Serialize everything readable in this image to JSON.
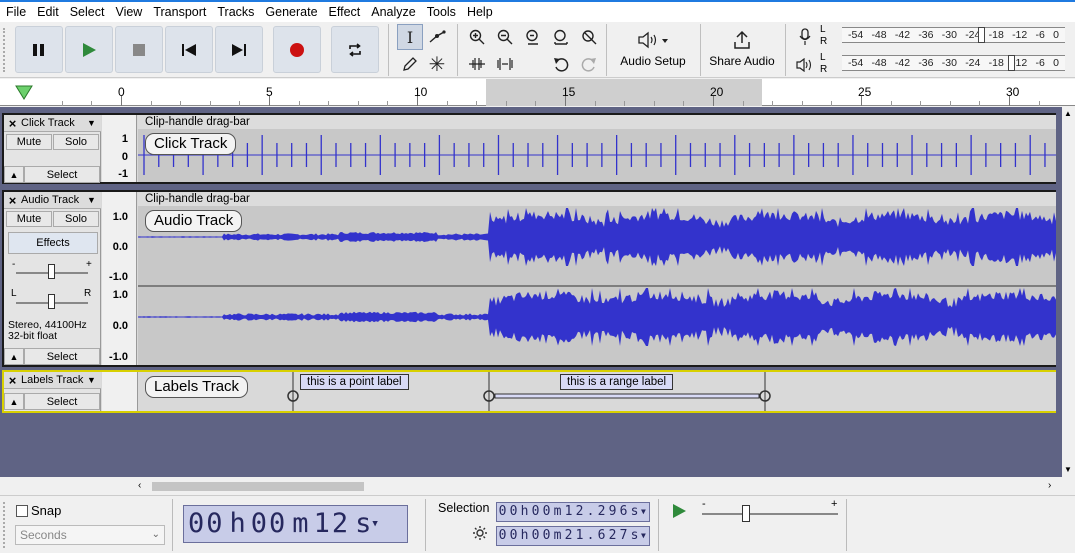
{
  "menu": [
    "File",
    "Edit",
    "Select",
    "View",
    "Transport",
    "Tracks",
    "Generate",
    "Effect",
    "Analyze",
    "Tools",
    "Help"
  ],
  "toolbar": {
    "audio_setup_label": "Audio Setup",
    "share_audio_label": "Share Audio",
    "record_meter_labels": [
      "-54",
      "-48",
      "-42",
      "-36",
      "-30",
      "-24",
      "-18",
      "-12",
      "-6",
      "0"
    ],
    "play_meter_labels": [
      "-54",
      "-48",
      "-42",
      "-36",
      "-30",
      "-24",
      "-18",
      "-12",
      "-6",
      "0"
    ],
    "meter_channel_l": "L",
    "meter_channel_r": "R"
  },
  "ruler": {
    "labels": [
      "0",
      "5",
      "10",
      "15",
      "20",
      "25",
      "30"
    ],
    "selection_start": 12.296,
    "selection_end": 21.627
  },
  "tracks": {
    "click": {
      "name": "Click Track",
      "mute": "Mute",
      "solo": "Solo",
      "select": "Select",
      "drag_bar": "Clip-handle drag-bar",
      "label": "Click Track",
      "scale": [
        "1",
        "0",
        "-1"
      ]
    },
    "audio": {
      "name": "Audio Track",
      "mute": "Mute",
      "solo": "Solo",
      "effects": "Effects",
      "pan_left": "L",
      "pan_right": "R",
      "gain_minus": "-",
      "gain_plus": "+",
      "format_line1": "Stereo, 44100Hz",
      "format_line2": "32-bit float",
      "select": "Select",
      "drag_bar": "Clip-handle drag-bar",
      "label": "Audio Track",
      "scale_top": [
        "1.0",
        "0.0",
        "-1.0"
      ],
      "scale_bottom": [
        "1.0",
        "0.0",
        "-1.0"
      ]
    },
    "labels": {
      "name": "Labels Track",
      "select": "Select",
      "label": "Labels Track",
      "point_label": "this is a point label",
      "range_label": "this is a range label"
    }
  },
  "bottom": {
    "snap_label": "Snap",
    "snap_unit": "Seconds",
    "time_hh": "00",
    "time_mm": "00",
    "time_ss": "12",
    "time_h_unit": "h",
    "time_m_unit": "m",
    "time_s_unit": "s",
    "selection_label": "Selection",
    "sel_start": [
      "0",
      "0",
      "h",
      "0",
      "0",
      "m",
      "1",
      "2",
      ".",
      "2",
      "9",
      "6",
      "s"
    ],
    "sel_end": [
      "0",
      "0",
      "h",
      "0",
      "0",
      "m",
      "2",
      "1",
      ".",
      "6",
      "2",
      "7",
      "s"
    ],
    "speed_minus": "-",
    "speed_plus": "+"
  },
  "colors": {
    "waveform": "#3333cc",
    "track_bg": "#5f6384",
    "record": "#cc1111",
    "play": "#2f8a3b"
  }
}
